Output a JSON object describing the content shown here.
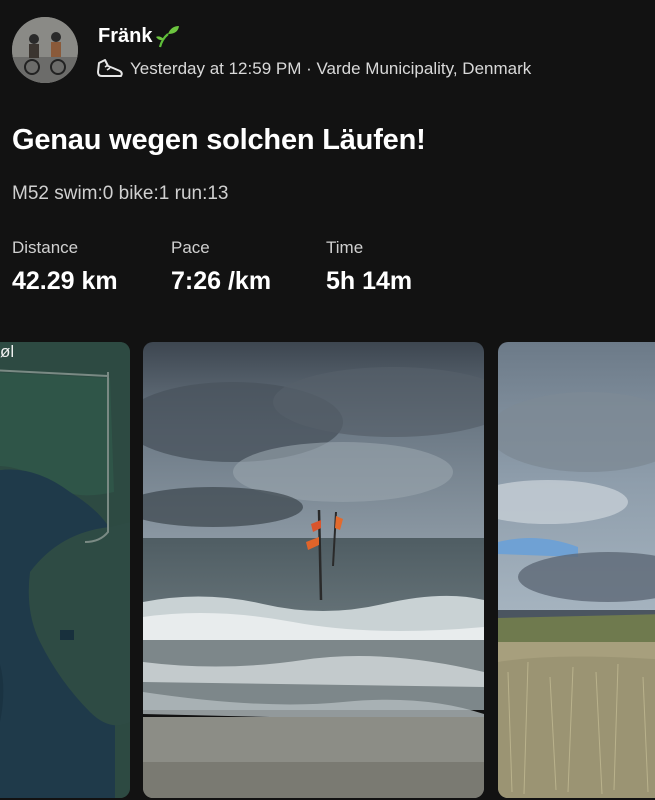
{
  "activity": {
    "athlete_name": "Fränk",
    "timestamp": "Yesterday at 12:59 PM",
    "separator": " · ",
    "location": "Varde Municipality, Denmark",
    "title": "Genau wegen solchen Läufen!",
    "description": "M52 swim:0 bike:1 run:13",
    "icons": {
      "sport": "running-shoe-icon",
      "name_badge": "sprout-icon"
    }
  },
  "stats": {
    "distance": {
      "label": "Distance",
      "value": "42.29 km"
    },
    "pace": {
      "label": "Pace",
      "value": "7:26 /km"
    },
    "time": {
      "label": "Time",
      "value": "5h 14m"
    }
  },
  "media": {
    "map_label": "øl",
    "colors": {
      "map_water": "#1f3a4a",
      "map_land": "#2c4a42",
      "sea": "#5f6f77",
      "sky": "#7d8a96"
    }
  }
}
